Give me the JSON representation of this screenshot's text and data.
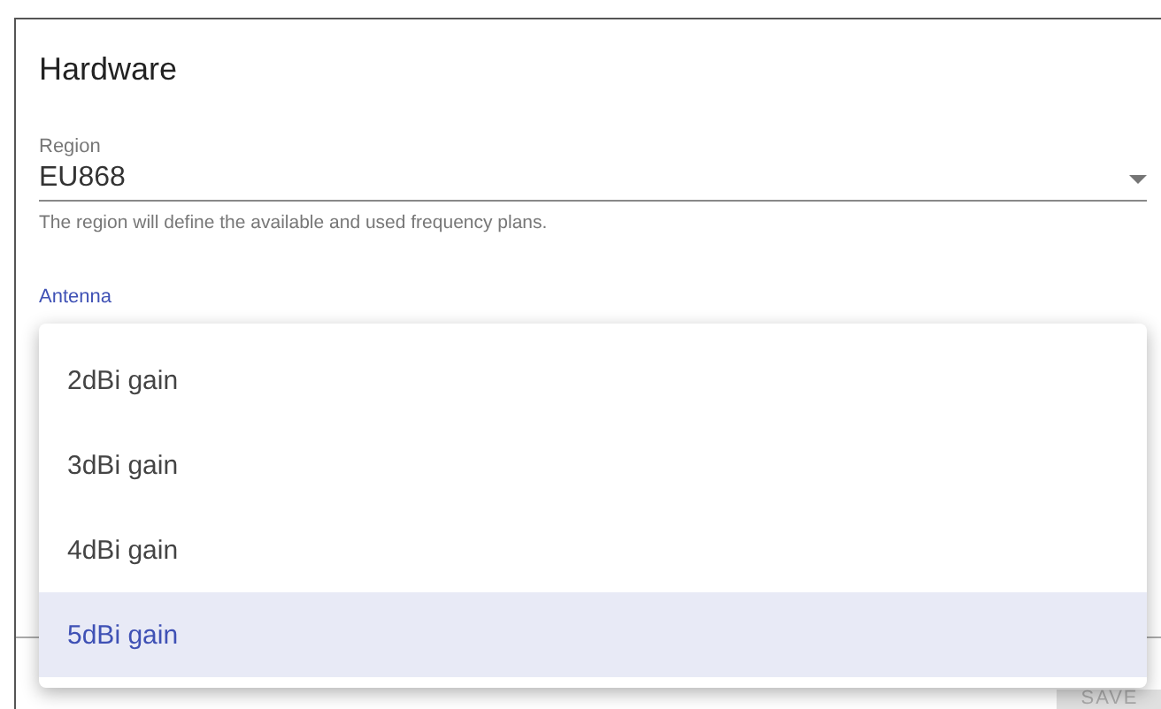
{
  "card": {
    "title": "Hardware"
  },
  "region": {
    "label": "Region",
    "value": "EU868",
    "helper": "The region will define the available and used frequency plans."
  },
  "antenna": {
    "label": "Antenna",
    "options": [
      {
        "label": "2dBi gain",
        "selected": false
      },
      {
        "label": "3dBi gain",
        "selected": false
      },
      {
        "label": "4dBi gain",
        "selected": false
      },
      {
        "label": "5dBi gain",
        "selected": true
      }
    ]
  },
  "actions": {
    "save": "SAVE"
  }
}
